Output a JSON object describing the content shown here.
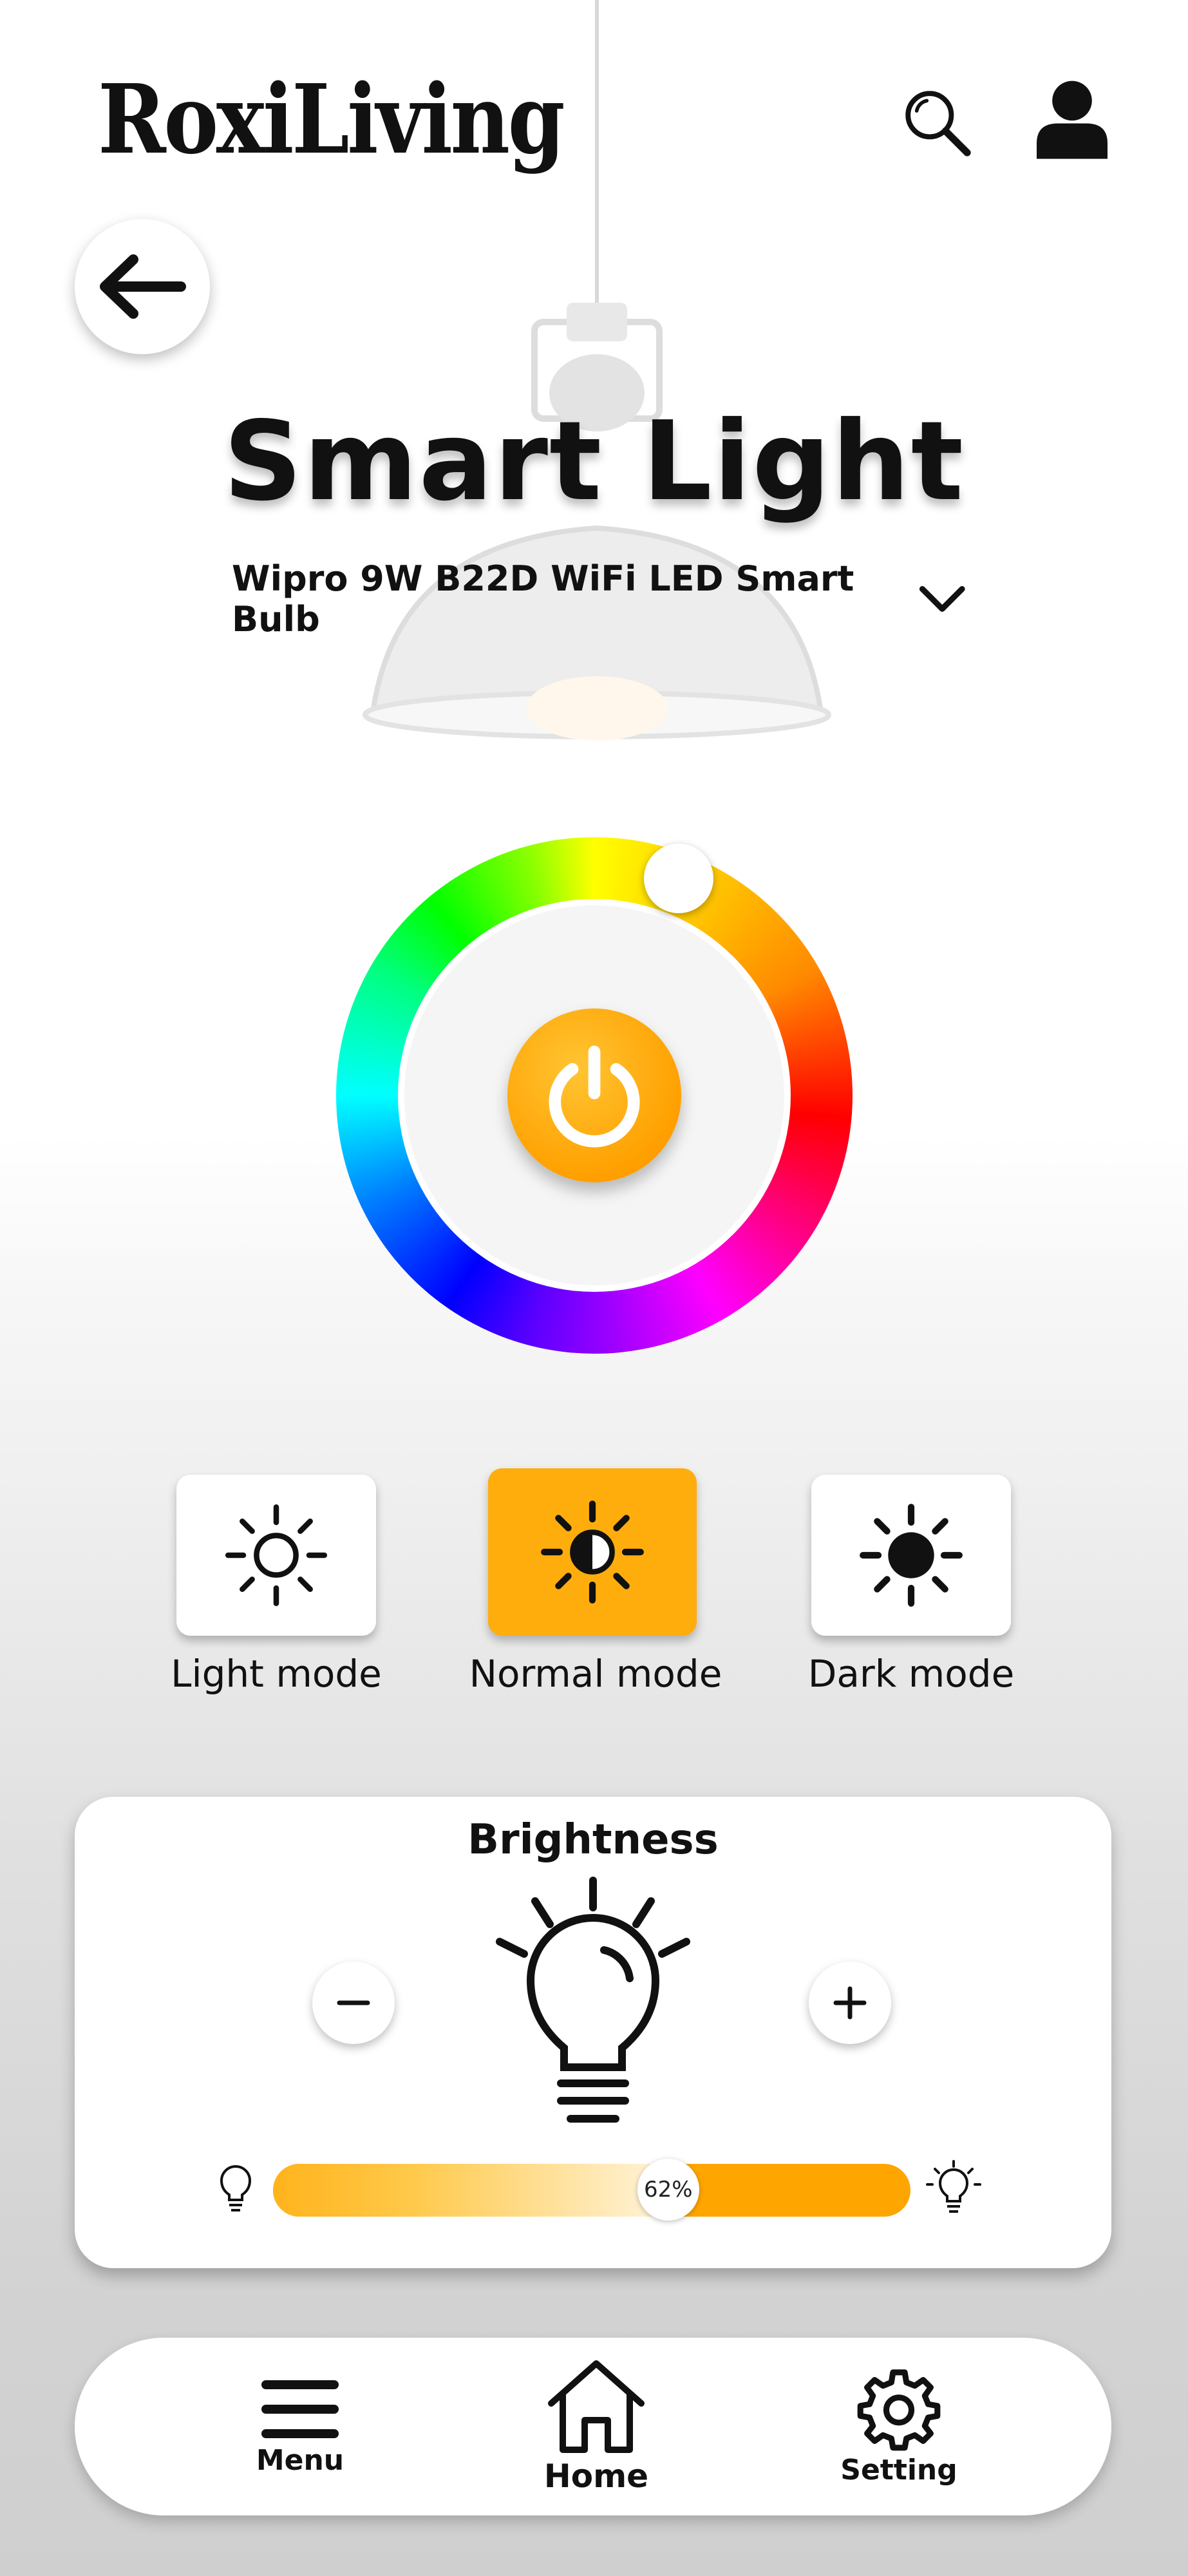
{
  "app": {
    "brand": "RoxiLiving"
  },
  "header": {
    "title": "Smart Light"
  },
  "device": {
    "selected": "Wipro 9W B22D WiFi LED Smart Bulb"
  },
  "modes": [
    {
      "label": "Light mode",
      "active": false
    },
    {
      "label": "Normal mode",
      "active": true
    },
    {
      "label": "Dark mode",
      "active": false
    }
  ],
  "brightness": {
    "title": "Brightness",
    "value_label": "62%",
    "value": 0.62
  },
  "nav": {
    "menu": "Menu",
    "home": "Home",
    "setting": "Setting"
  },
  "colors": {
    "accent": "#ffa500",
    "text": "#111111",
    "card": "#ffffff"
  },
  "icons": {
    "search": "search-icon",
    "user": "user-icon",
    "back": "arrow-left-icon",
    "chevron": "chevron-down-icon",
    "power": "power-icon",
    "light": "sun-outline-icon",
    "normal": "sun-half-icon",
    "dark": "sun-filled-icon",
    "bulb": "lightbulb-icon",
    "menu": "menu-icon",
    "home": "home-icon",
    "setting": "gear-icon"
  }
}
